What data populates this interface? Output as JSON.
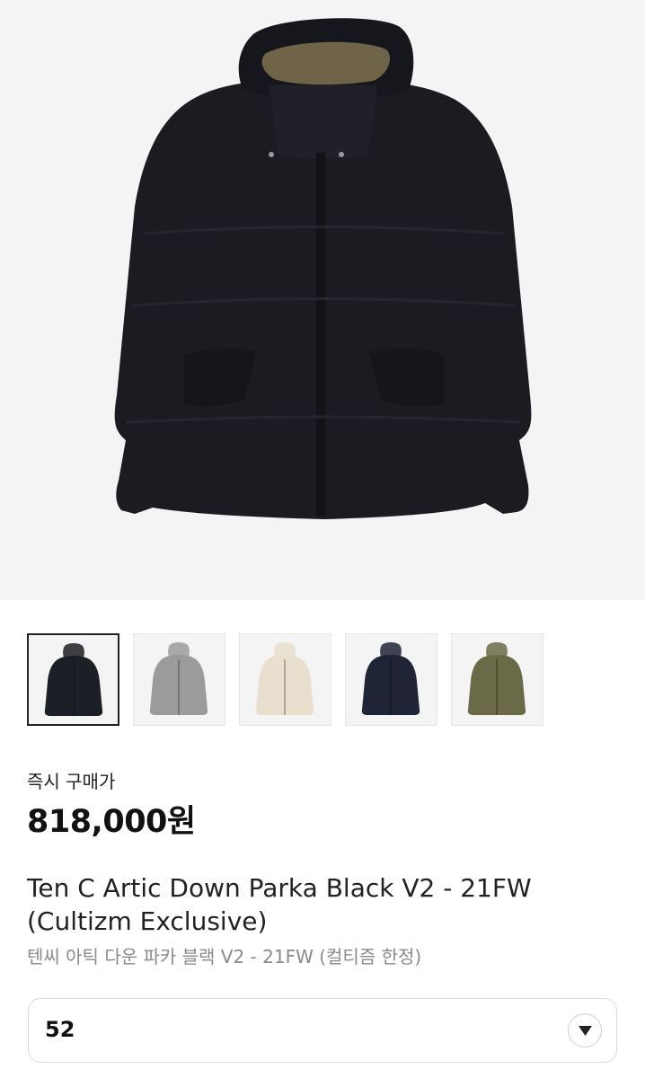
{
  "product": {
    "main_image": "black-down-parka-photo",
    "buy_label": "즉시 구매가",
    "price": "818,000원",
    "title_en": "Ten C Artic Down Parka Black V2 - 21FW (Cultizm Exclusive)",
    "title_ko": "텐씨 아틱 다운 파카 블랙 V2 - 21FW (컬티즘 한정)"
  },
  "thumbnails": [
    {
      "color_name": "black",
      "color": "#1d1f26",
      "selected": true
    },
    {
      "color_name": "grey",
      "color": "#9a9b9c",
      "selected": false
    },
    {
      "color_name": "beige",
      "color": "#e8dfcf",
      "selected": false
    },
    {
      "color_name": "navy",
      "color": "#1f2436",
      "selected": false
    },
    {
      "color_name": "olive",
      "color": "#6b6a48",
      "selected": false
    }
  ],
  "size_select": {
    "value": "52",
    "icon": "chevron-down-icon"
  }
}
